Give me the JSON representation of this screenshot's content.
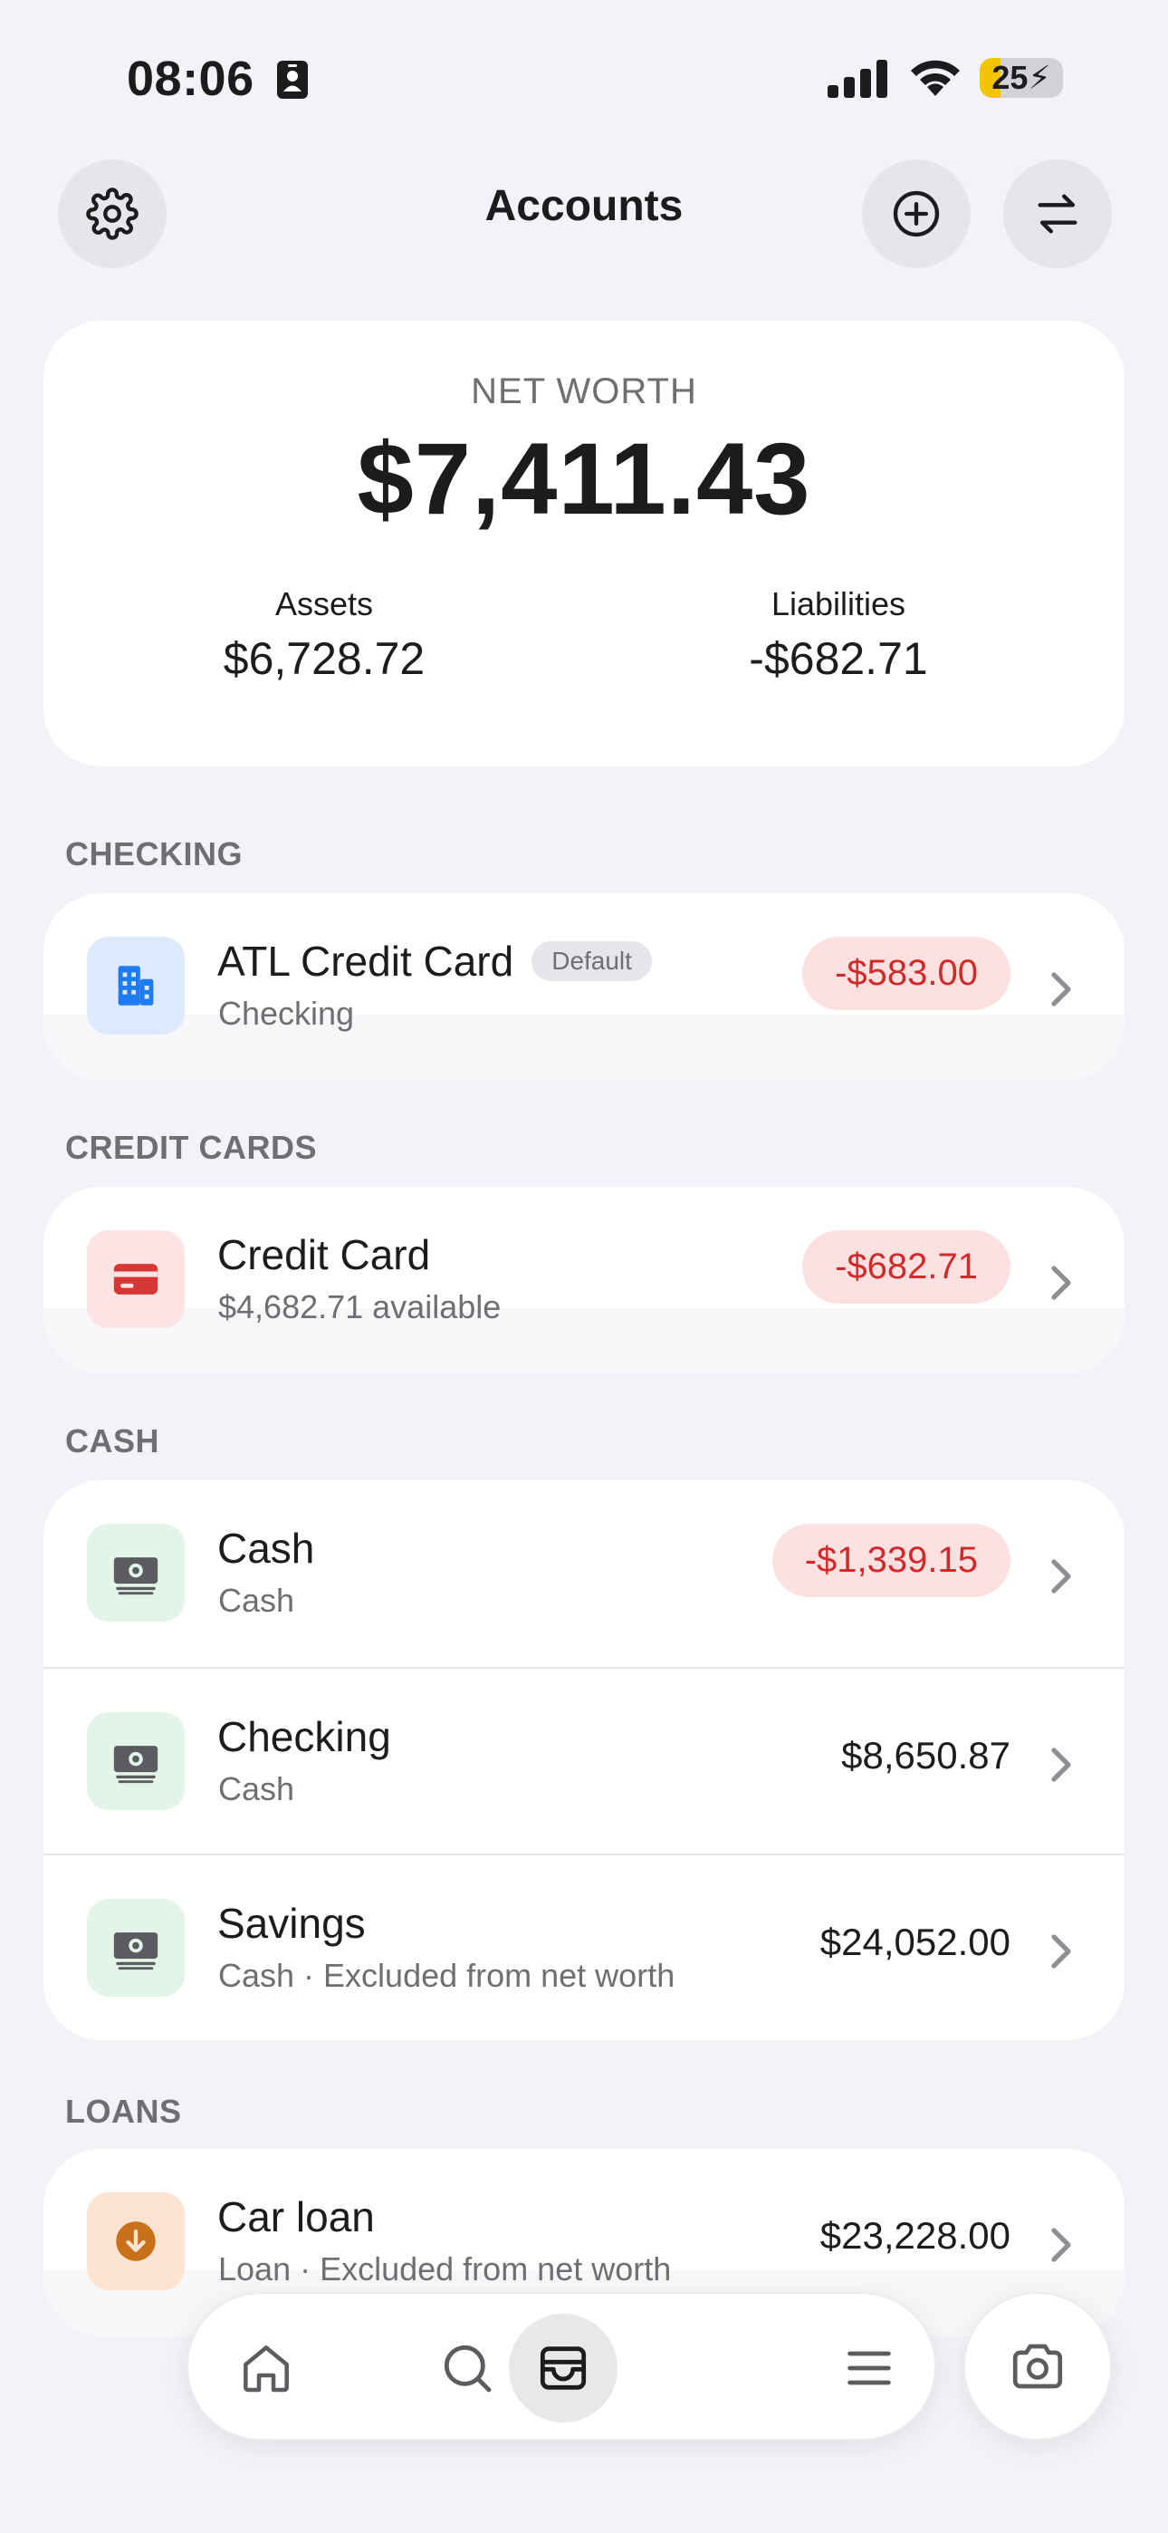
{
  "status_bar": {
    "time": "08:06",
    "battery": "25",
    "battery_level": 0.25
  },
  "header": {
    "title": "Accounts"
  },
  "net_worth": {
    "label": "NET WORTH",
    "value": "$7,411.43",
    "assets_label": "Assets",
    "assets_value": "$6,728.72",
    "liabilities_label": "Liabilities",
    "liabilities_value": "-$682.71"
  },
  "sections": {
    "checking": {
      "title": "CHECKING",
      "rows": [
        {
          "name": "ATL Credit Card",
          "badge": "Default",
          "sub": "Checking",
          "amount": "-$583.00"
        }
      ]
    },
    "credit_cards": {
      "title": "CREDIT CARDS",
      "rows": [
        {
          "name": "Credit Card",
          "sub": "$4,682.71 available",
          "amount": "-$682.71"
        }
      ]
    },
    "cash": {
      "title": "CASH",
      "rows": [
        {
          "name": "Cash",
          "sub": "Cash",
          "amount": "-$1,339.15"
        },
        {
          "name": "Checking",
          "sub": "Cash",
          "amount": "$8,650.87"
        },
        {
          "name": "Savings",
          "sub": "Cash · Excluded from net worth",
          "amount": "$24,052.00"
        }
      ]
    },
    "loans": {
      "title": "LOANS",
      "rows": [
        {
          "name": "Car loan",
          "sub": "Loan · Excluded from net worth",
          "amount": "$23,228.00"
        }
      ]
    }
  },
  "colors": {
    "background": "#f2f2f7",
    "negative_text": "#d12a2a",
    "negative_bg": "#fde1e1",
    "bank_icon": "#1e7cf2",
    "card_icon": "#d63636",
    "cash_icon": "#5b5b60",
    "loan_icon": "#c9701a"
  },
  "icons": {
    "settings": "gear-icon",
    "add": "plus-circle-icon",
    "transfer": "arrows-swap-icon",
    "bank": "building-icon",
    "credit_card": "credit-card-icon",
    "cash": "banknote-icon",
    "loan": "arrow-down-circle-icon",
    "tabs": [
      "home-icon",
      "search-icon",
      "wallet-icon",
      "menu-icon"
    ],
    "camera": "camera-icon"
  }
}
